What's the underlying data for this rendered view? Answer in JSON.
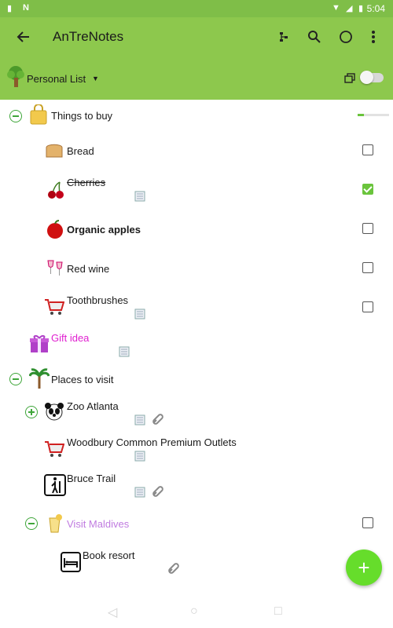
{
  "status_bar": {
    "time": "5:04"
  },
  "app_bar": {
    "title": "AnTreNotes",
    "back_icon": "arrow-left-icon",
    "icons": [
      "tree-structure-icon",
      "search-icon",
      "circle-icon",
      "more-vert-icon"
    ]
  },
  "sub_bar": {
    "list_name": "Personal List",
    "toggle_on": false
  },
  "items": [
    {
      "label": "Things to buy",
      "progress_fraction": 0.2
    },
    {
      "label": "Bread",
      "checked": false
    },
    {
      "label": "Cherries",
      "checked": true,
      "strikethrough": true
    },
    {
      "label": "Organic apples",
      "checked": false,
      "bold": true
    },
    {
      "label": "Red wine",
      "checked": false
    },
    {
      "label": "Toothbrushes",
      "checked": false
    },
    {
      "label": "Gift idea",
      "color": "#e020d0"
    },
    {
      "label": "Places to visit"
    },
    {
      "label": "Zoo Atlanta"
    },
    {
      "label": "Woodbury Common Premium Outlets"
    },
    {
      "label": "Bruce Trail"
    },
    {
      "label": "Visit Maldives",
      "color": "#c07be0",
      "checked": false
    },
    {
      "label": "Book resort"
    }
  ],
  "fab": {
    "label": "+"
  },
  "colors": {
    "app_bar": "#8dc84d",
    "accent": "#6ac43c",
    "fab": "#66dd2b"
  }
}
